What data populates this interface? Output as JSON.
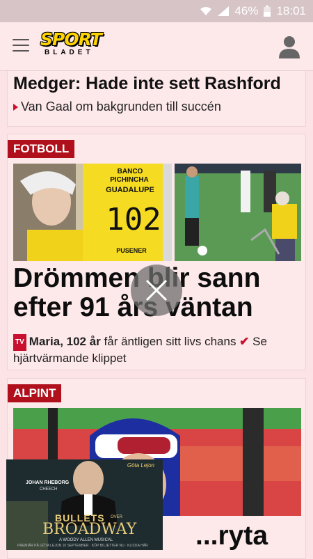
{
  "status_bar": {
    "battery": "46%",
    "time": "18:01"
  },
  "app_bar": {
    "logo_word_top": "SPORT",
    "logo_word_bottom": "BLADET",
    "menu_icon": "hamburger-menu-icon",
    "profile_icon": "user-profile-icon"
  },
  "articles": [
    {
      "headline": "Medger: Hade inte sett Rashford",
      "sublink": "Van Gaal om bakgrunden till succén"
    },
    {
      "tag": "FOTBOLL",
      "headline": "Drömmen blir sann efter 91 års väntan",
      "badge": "TV",
      "desc_bold": "Maria, 102 år",
      "desc_text": " får äntligen sitt livs chans ",
      "desc_link": " Se hjärtvärmande klippet",
      "shirt_line1": "BANCO",
      "shirt_line2": "PICHINCHA",
      "shirt_line3": "GUADALUPE",
      "shirt_number": "102",
      "shirt_sponsor": "PUSENER"
    },
    {
      "tag": "ALPINT",
      "headline": "...ryta"
    }
  ],
  "ad": {
    "brand": "Göta Lejon",
    "actor": "JOHAN RHEBORG",
    "actor_role": "CHEECH",
    "title_small": "BULLETS",
    "title_over": "OVER",
    "title_main": "BROADWAY",
    "subtitle": "A WOODY ALLEN MUSICAL",
    "bottom_line": "PREMIÄR PÅ GÖTA LEJON 10 SEPTEMBER · KÖP BILJETTER NU · KLICKA HÄR"
  },
  "colors": {
    "accent": "#b0101c",
    "background": "#fbe3e6",
    "logo_yellow": "#ffd400"
  }
}
